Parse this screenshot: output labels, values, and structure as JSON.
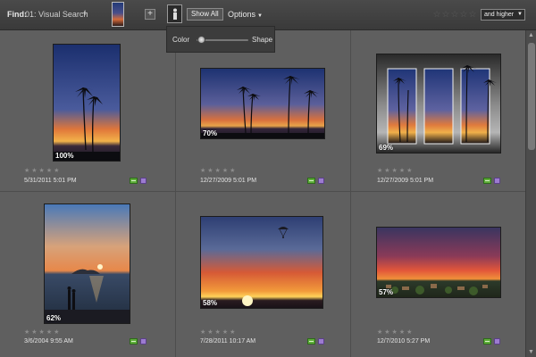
{
  "findbar": {
    "label": "Find:",
    "query": "01: Visual Search",
    "add_symbol": "+",
    "plus_button": "+",
    "show_all": "Show All",
    "options": "Options",
    "rating_filter": "and higher"
  },
  "popup": {
    "color_label": "Color",
    "shape_label": "Shape",
    "slider_value": 0.1
  },
  "colors": {
    "background": "#5f5f5f",
    "toolbar": "#3a3a3a",
    "tag_green": "#5fae3a",
    "people_purple": "#9c7bd0"
  },
  "results": [
    {
      "match": "100%",
      "date": "5/31/2011 5:01 PM",
      "stars": "★★★★★"
    },
    {
      "match": "70%",
      "date": "12/27/2009 5:01 PM",
      "stars": "★★★★★"
    },
    {
      "match": "69%",
      "date": "12/27/2009 5:01 PM",
      "stars": "★★★★★"
    },
    {
      "match": "62%",
      "date": "3/6/2004 9:55 AM",
      "stars": "★★★★★"
    },
    {
      "match": "58%",
      "date": "7/28/2011 10:17 AM",
      "stars": "★★★★★"
    },
    {
      "match": "57%",
      "date": "12/7/2010 5:27 PM",
      "stars": "★★★★★"
    }
  ]
}
